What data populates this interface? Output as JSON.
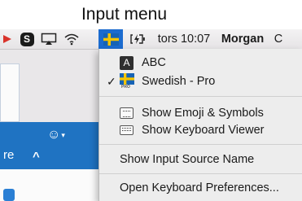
{
  "caption": "Input menu",
  "menubar": {
    "skype_glyph": "S",
    "time": "tors 10:07",
    "user": "Morgan",
    "overflow_char": "C",
    "icons": [
      "app-icon",
      "skype-icon",
      "airplay-icon",
      "wifi-icon",
      "input-source-flag-icon",
      "battery-charging-icon",
      "spotlight-icon"
    ]
  },
  "background": {
    "emoji_button_glyph": "☺",
    "dropdown_glyph": "▾",
    "panel_label": "re",
    "chevron_glyph": "^"
  },
  "menu": {
    "items": [
      {
        "label": "ABC",
        "badge": "A",
        "checked": false
      },
      {
        "label": "Swedish - Pro",
        "flag_badge": "PRO",
        "checked": true
      },
      {
        "label": "Show Emoji & Symbols"
      },
      {
        "label": "Show Keyboard Viewer"
      },
      {
        "label": "Show Input Source Name"
      },
      {
        "label": "Open Keyboard Preferences..."
      }
    ],
    "checkmark": "✓"
  },
  "colors": {
    "menu_bg": "#ededed",
    "highlight_flag_bg": "#1b6bcf",
    "swedish_blue": "#1663b5",
    "swedish_yellow": "#f5c400",
    "win_blue": "#1f73c2"
  }
}
